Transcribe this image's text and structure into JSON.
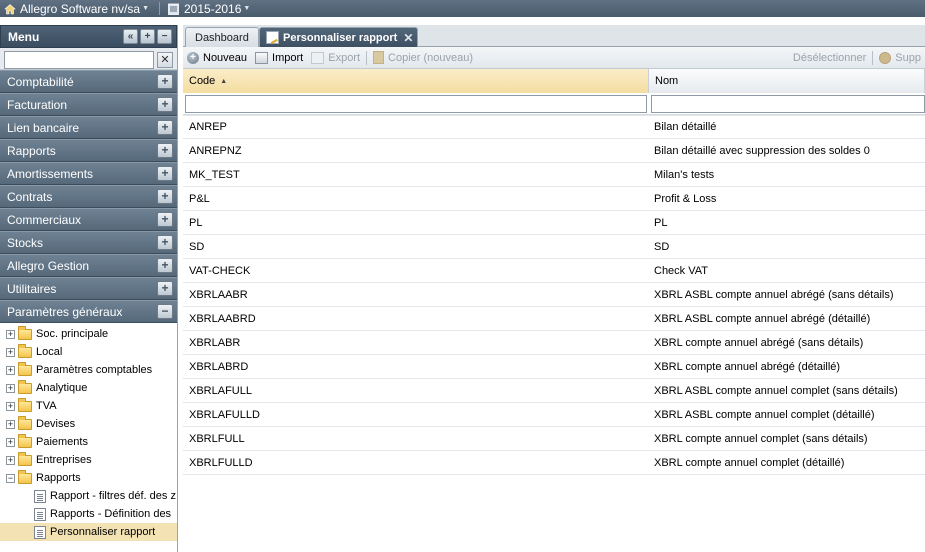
{
  "topbar": {
    "company": "Allegro Software nv/sa",
    "year": "2015-2016"
  },
  "menu": {
    "title": "Menu",
    "search_value": "",
    "sections": [
      "Comptabilité",
      "Facturation",
      "Lien bancaire",
      "Rapports",
      "Amortissements",
      "Contrats",
      "Commerciaux",
      "Stocks",
      "Allegro Gestion",
      "Utilitaires"
    ],
    "open_section": "Paramètres généraux",
    "tree": [
      "Soc. principale",
      "Local",
      "Paramètres comptables",
      "Analytique",
      "TVA",
      "Devises",
      "Paiements",
      "Entreprises",
      "Rapports"
    ],
    "tree_children": [
      "Rapport - filtres déf. des z",
      "Rapports - Définition des",
      "Personnaliser rapport"
    ]
  },
  "tabs": {
    "dashboard": "Dashboard",
    "active": "Personnaliser rapport"
  },
  "toolbar": {
    "new": "Nouveau",
    "import": "Import",
    "export": "Export",
    "copy_new": "Copier (nouveau)",
    "deselect": "Désélectionner",
    "delete": "Supp"
  },
  "grid": {
    "col_code": "Code",
    "col_nom": "Nom",
    "rows": [
      {
        "code": "ANREP",
        "nom": "Bilan détaillé"
      },
      {
        "code": "ANREPNZ",
        "nom": "Bilan détaillé avec suppression des soldes 0"
      },
      {
        "code": "MK_TEST",
        "nom": "Milan's tests"
      },
      {
        "code": "P&L",
        "nom": "Profit & Loss"
      },
      {
        "code": "PL",
        "nom": "PL"
      },
      {
        "code": "SD",
        "nom": "SD"
      },
      {
        "code": "VAT-CHECK",
        "nom": "Check VAT"
      },
      {
        "code": "XBRLAABR",
        "nom": "XBRL ASBL compte annuel abrégé (sans détails)"
      },
      {
        "code": "XBRLAABRD",
        "nom": "XBRL ASBL compte annuel abrégé (détaillé)"
      },
      {
        "code": "XBRLABR",
        "nom": "XBRL compte annuel abrégé (sans détails)"
      },
      {
        "code": "XBRLABRD",
        "nom": "XBRL compte annuel abrégé (détaillé)"
      },
      {
        "code": "XBRLAFULL",
        "nom": "XBRL ASBL compte annuel complet (sans détails)"
      },
      {
        "code": "XBRLAFULLD",
        "nom": "XBRL ASBL compte annuel complet (détaillé)"
      },
      {
        "code": "XBRLFULL",
        "nom": "XBRL compte annuel complet (sans détails)"
      },
      {
        "code": "XBRLFULLD",
        "nom": "XBRL compte annuel complet (détaillé)"
      }
    ]
  }
}
